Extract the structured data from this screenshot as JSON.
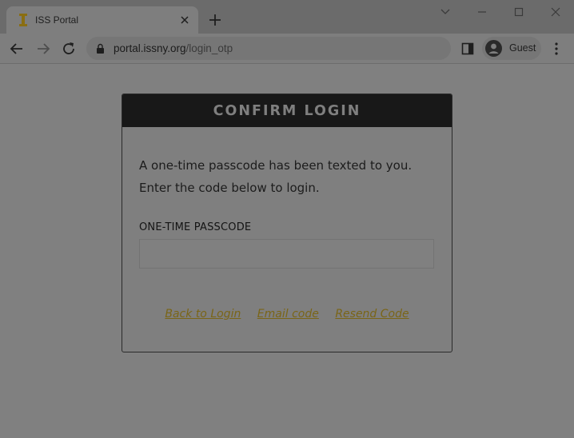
{
  "browser": {
    "tab": {
      "title": "ISS Portal",
      "favicon": "iss-logo-icon"
    },
    "url": {
      "host": "portal.issny.org",
      "path": "/login_otp"
    },
    "profile": {
      "label": "Guest"
    }
  },
  "card": {
    "title": "CONFIRM LOGIN",
    "message_line1": "A one-time passcode has been texted to you.",
    "message_line2": "Enter the code below to login.",
    "field_label": "ONE-TIME PASSCODE",
    "field_value": "",
    "field_placeholder": "",
    "links": {
      "back": "Back to Login",
      "email": "Email code",
      "resend": "Resend Code"
    }
  },
  "colors": {
    "header_bg": "#181818",
    "link": "#7a6517",
    "page_bg": "#808080"
  }
}
